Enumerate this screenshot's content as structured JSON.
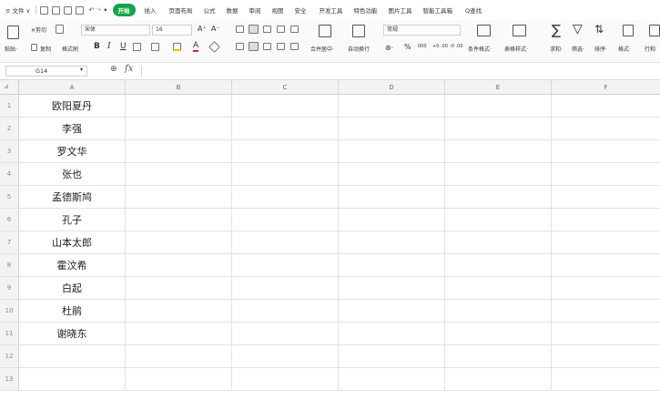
{
  "menu": {
    "file": "≡ 文件 ∨",
    "start": "开始",
    "tabs": [
      "插入",
      "页面布局",
      "公式",
      "数据",
      "审阅",
      "视图",
      "安全",
      "开发工具",
      "特色功能",
      "图片工具",
      "智能工具箱"
    ],
    "search": "Q查找"
  },
  "ribbon": {
    "paste": "粘贴·",
    "cut": "✕剪切",
    "copy": "复制",
    "format_painter": "格式刷",
    "font_name": "宋体",
    "font_size": "16",
    "grow": "A⁺",
    "shrink": "A⁻",
    "bold": "B",
    "italic": "I",
    "underline": "U",
    "merge_center": "合并居中·",
    "wrap": "自动换行",
    "number_format": "常规",
    "percent": "%",
    "thousands": "000",
    "inc_decimal": "+0 .00",
    "dec_decimal": "-0 .00",
    "cond_format": "条件格式·",
    "table_style": "表格样式·",
    "sum": "求和·",
    "filter": "筛选·",
    "sort": "排序·",
    "format": "格式·",
    "rowcol": "行和"
  },
  "formula_bar": {
    "name_box": "G14",
    "fx": "fx",
    "zoom_icon": "⊕",
    "value": ""
  },
  "sheet": {
    "columns": [
      "A",
      "B",
      "C",
      "D",
      "E",
      "F"
    ],
    "rows": [
      {
        "num": "1",
        "a": "欧阳夏丹"
      },
      {
        "num": "2",
        "a": "李强"
      },
      {
        "num": "3",
        "a": "罗文华"
      },
      {
        "num": "4",
        "a": "张也"
      },
      {
        "num": "5",
        "a": "孟德斯鸠"
      },
      {
        "num": "6",
        "a": "孔子"
      },
      {
        "num": "7",
        "a": "山本太郎"
      },
      {
        "num": "8",
        "a": "霍汶希"
      },
      {
        "num": "9",
        "a": "白起"
      },
      {
        "num": "10",
        "a": "杜鹃"
      },
      {
        "num": "11",
        "a": "谢晓东"
      },
      {
        "num": "12",
        "a": ""
      },
      {
        "num": "13",
        "a": ""
      }
    ]
  },
  "colors": {
    "start_tab": "#16a34a",
    "header_bg": "#f3f3f3",
    "grid_line": "#e2e2e2"
  }
}
